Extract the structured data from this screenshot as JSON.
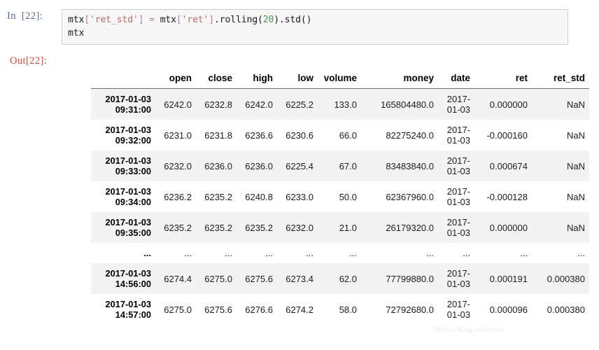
{
  "input_cell": {
    "prompt": "In  [22]:",
    "lines": [
      [
        {
          "t": "mtx",
          "k": "plain"
        },
        {
          "t": "[",
          "k": "op"
        },
        {
          "t": "'ret_std'",
          "k": "str"
        },
        {
          "t": "]",
          "k": "op"
        },
        {
          "t": " ",
          "k": "plain"
        },
        {
          "t": "=",
          "k": "op"
        },
        {
          "t": " mtx",
          "k": "plain"
        },
        {
          "t": "[",
          "k": "op"
        },
        {
          "t": "'ret'",
          "k": "str"
        },
        {
          "t": "]",
          "k": "op"
        },
        {
          "t": ".rolling(",
          "k": "plain"
        },
        {
          "t": "20",
          "k": "num"
        },
        {
          "t": ").std()",
          "k": "plain"
        }
      ],
      [
        {
          "t": "mtx",
          "k": "plain"
        }
      ]
    ]
  },
  "output_cell": {
    "prompt": "Out[22]:",
    "table": {
      "index_header": "",
      "columns": [
        "open",
        "close",
        "high",
        "low",
        "volume",
        "money",
        "date",
        "ret",
        "ret_std"
      ],
      "rows": [
        {
          "index": "2017-01-03 09:31:00",
          "cells": [
            "6242.0",
            "6232.8",
            "6242.0",
            "6225.2",
            "133.0",
            "165804480.0",
            "2017-01-03",
            "0.000000",
            "NaN"
          ]
        },
        {
          "index": "2017-01-03 09:32:00",
          "cells": [
            "6231.0",
            "6231.8",
            "6236.6",
            "6230.6",
            "66.0",
            "82275240.0",
            "2017-01-03",
            "-0.000160",
            "NaN"
          ]
        },
        {
          "index": "2017-01-03 09:33:00",
          "cells": [
            "6232.0",
            "6236.0",
            "6236.0",
            "6225.4",
            "67.0",
            "83483840.0",
            "2017-01-03",
            "0.000674",
            "NaN"
          ]
        },
        {
          "index": "2017-01-03 09:34:00",
          "cells": [
            "6236.2",
            "6235.2",
            "6240.8",
            "6233.0",
            "50.0",
            "62367960.0",
            "2017-01-03",
            "-0.000128",
            "NaN"
          ]
        },
        {
          "index": "2017-01-03 09:35:00",
          "cells": [
            "6235.2",
            "6235.2",
            "6235.2",
            "6232.0",
            "21.0",
            "26179320.0",
            "2017-01-03",
            "0.000000",
            "NaN"
          ]
        },
        {
          "index": "...",
          "cells": [
            "...",
            "...",
            "...",
            "...",
            "...",
            "...",
            "...",
            "...",
            "..."
          ]
        },
        {
          "index": "2017-01-03 14:56:00",
          "cells": [
            "6274.4",
            "6275.0",
            "6275.6",
            "6273.4",
            "62.0",
            "77799880.0",
            "2017-01-03",
            "0.000191",
            "0.000380"
          ]
        },
        {
          "index": "2017-01-03 14:57:00",
          "cells": [
            "6275.0",
            "6275.6",
            "6276.6",
            "6274.2",
            "58.0",
            "72792680.0",
            "2017-01-03",
            "0.000096",
            "0.000380"
          ]
        }
      ]
    }
  },
  "watermark": {
    "text": "https://blog.csdn.net"
  },
  "colors": {
    "prompt_in": "#5a6e8c",
    "prompt_out": "#d14836",
    "code_bg": "#f7f7f7",
    "code_border": "#cfcfcf",
    "string_token": "#bb6a70",
    "number_token": "#4a9a52",
    "operator_token": "#b07ebd",
    "row_stripe": "#f3f3f3",
    "header_rule": "#6f6f6f"
  }
}
